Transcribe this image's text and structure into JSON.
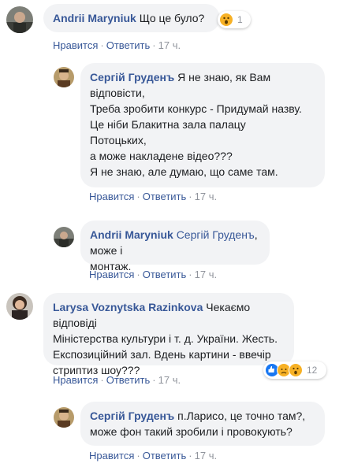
{
  "comments": [
    {
      "author": "Andrii Maryniuk",
      "text": "Що це було?",
      "reaction_count": "1",
      "actions": {
        "like": "Нравится",
        "reply": "Ответить",
        "time": "17 ч."
      }
    },
    {
      "author": "Сергій Груденъ",
      "lines": [
        "Я не знаю, як Вам",
        "відповісти,",
        "Треба зробити конкурс - Придумай назву.",
        "Це ніби Блакитна зала палацу",
        "Потоцьких,",
        "а може накладене відео???",
        "Я не знаю, але думаю, що саме там."
      ],
      "actions": {
        "like": "Нравится",
        "reply": "Ответить",
        "time": "17 ч."
      }
    },
    {
      "author": "Andrii Maryniuk",
      "mention": "Сергій Груденъ",
      "text_after_mention": ", може і",
      "line2": "монтаж.",
      "actions": {
        "like": "Нравится",
        "reply": "Ответить",
        "time": "17 ч."
      }
    },
    {
      "author": "Larysa Voznytska Razinkova",
      "line1_rest": "Чекаємо відповіді",
      "line2": "Міністерства культури і т. д. України. Жесть.",
      "line3": "Експозиційний зал. Вдень картини - ввечір",
      "line4": "стриптиз шоу???",
      "reaction_count": "12",
      "actions": {
        "like": "Нравится",
        "reply": "Ответить",
        "time": "17 ч."
      }
    },
    {
      "author": "Сергій Груденъ",
      "line1_rest": "п.Ларисо, це точно там?,",
      "line2": "може фон такий зробили і провокують?",
      "actions": {
        "like": "Нравится",
        "reply": "Ответить",
        "time": "17 ч."
      }
    }
  ],
  "colors": {
    "link": "#385898",
    "bubble": "#f2f3f5",
    "meta": "#90949c",
    "like_reaction": "#1877f2",
    "sad_wow_reaction": "#f7b125"
  },
  "icons": {
    "wow": "wow-reaction-icon",
    "like": "like-reaction-icon",
    "sad": "sad-reaction-icon"
  }
}
